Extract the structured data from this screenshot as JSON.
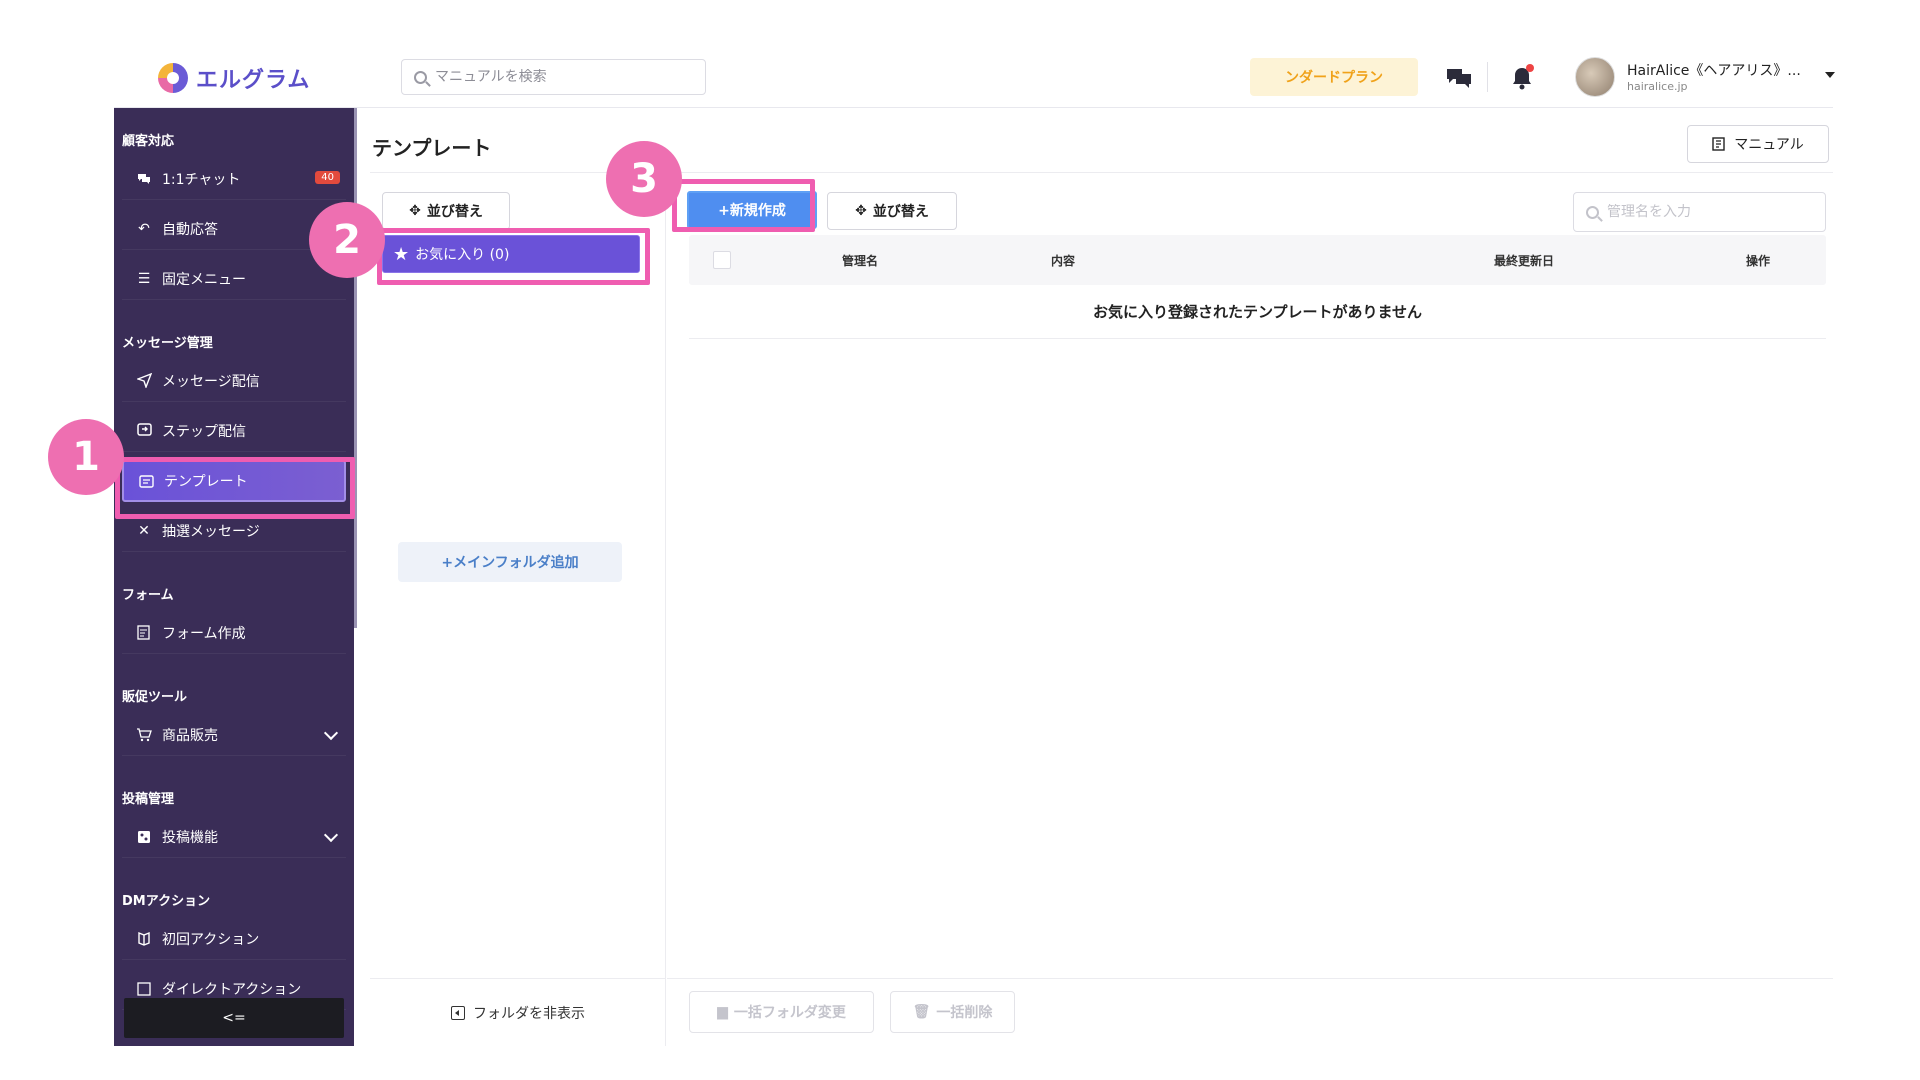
{
  "app": {
    "logo_text": "エルグラム",
    "search_placeholder": "マニュアルを検索",
    "plan_label": "ンダードプラン",
    "user_name": "HairAlice《ヘアアリス》...",
    "user_sub": "hairalice.jp"
  },
  "sidebar": {
    "sections": [
      {
        "label": "顧客対応"
      },
      {
        "label": "メッセージ管理"
      },
      {
        "label": "フォーム"
      },
      {
        "label": "販促ツール"
      },
      {
        "label": "投稿管理"
      },
      {
        "label": "DMアクション"
      }
    ],
    "items": [
      {
        "label": "1:1チャット",
        "icon": "chat-icon",
        "badge": "40"
      },
      {
        "label": "自動応答",
        "icon": "reply-icon"
      },
      {
        "label": "固定メニュー",
        "icon": "menu-icon"
      },
      {
        "label": "メッセージ配信",
        "icon": "send-icon"
      },
      {
        "label": "ステップ配信",
        "icon": "step-icon"
      },
      {
        "label": "テンプレート",
        "icon": "template-icon"
      },
      {
        "label": "抽選メッセージ",
        "icon": "shuffle-icon"
      },
      {
        "label": "フォーム作成",
        "icon": "form-icon"
      },
      {
        "label": "商品販売",
        "icon": "cart-icon"
      },
      {
        "label": "投稿機能",
        "icon": "post-icon"
      },
      {
        "label": "初回アクション",
        "icon": "book-icon"
      },
      {
        "label": "ダイレクトアクション",
        "icon": "direct-icon"
      }
    ],
    "collapse_label": "<="
  },
  "main": {
    "title": "テンプレート",
    "manual_label": "マニュアル",
    "folder_sort_label": "並び替え",
    "favorite_folder_label": "お気に入り (0)",
    "add_folder_label": "+メインフォルダ追加",
    "hide_folder_label": "フォルダを非表示",
    "new_label": "+新規作成",
    "sort_label": "並び替え",
    "table_search_placeholder": "管理名を入力",
    "columns": [
      "管理名",
      "内容",
      "最終更新日",
      "操作"
    ],
    "empty_message": "お気に入り登録されたテンプレートがありません",
    "bulk_folder_label": "一括フォルダ変更",
    "bulk_delete_label": "一括削除"
  },
  "annotations": {
    "steps": [
      "1",
      "2",
      "3"
    ],
    "color": "#ee6fb1"
  },
  "colors": {
    "sidebar_bg": "#3a2d57",
    "active": "#6a52d8",
    "primary_button": "#4f8ef0",
    "highlight": "#ef5db0"
  }
}
